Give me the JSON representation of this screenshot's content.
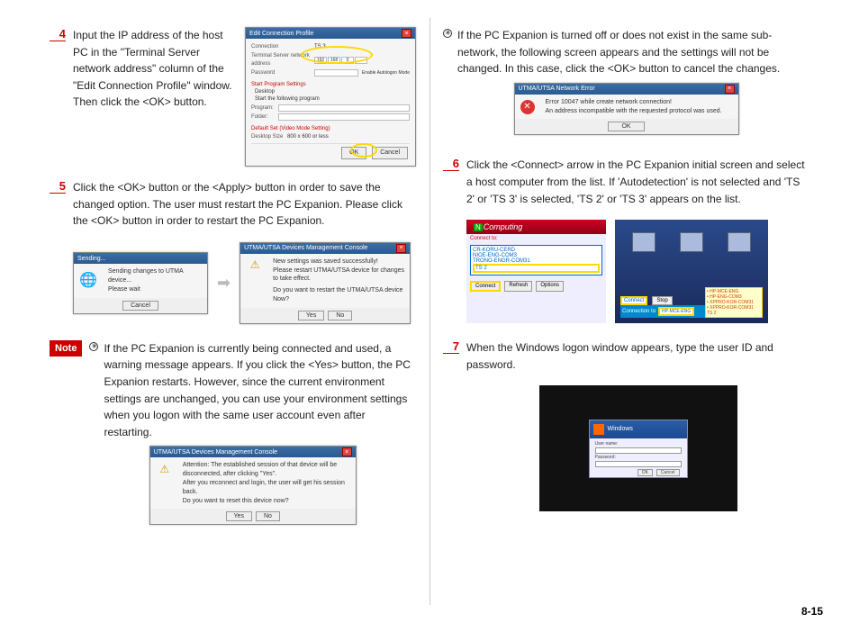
{
  "page_number": "8-15",
  "left": {
    "step4": {
      "num": "4",
      "text": "Input the IP address of the host PC in the \"Terminal Server network address\" column of the \"Edit Connection Profile\" window. Then click the <OK> button.",
      "dlg": {
        "title": "Edit Connection Profile",
        "conn_lbl": "Connection",
        "field1": "Terminal Server network address",
        "field2": "Password",
        "chk": "Enable Autologon Mode",
        "sect": "Start Program Settings",
        "opt1": "Desktop",
        "opt2": "Start the following program",
        "prog_lbl": "Program:",
        "fold_lbl": "Folder:",
        "mode_lbl": "Default Set (Video Mode Setting)",
        "desk_lbl": "Desktop Size",
        "desk_val": "800 x 600 or less",
        "ok": "OK",
        "cancel": "Cancel"
      }
    },
    "step5": {
      "num": "5",
      "text": "Click the <OK> button or the <Apply> button in order to save the changed option. The user must restart the PC Expanion. Please click the <OK> button in order to restart the PC Expanion.",
      "send": {
        "title": "Sending...",
        "msg": "Sending changes to UTMA device...\nPlease wait",
        "cancel": "Cancel"
      },
      "mgmt": {
        "title": "UTMA/UTSA Devices Management Console",
        "l1": "New settings was saved successfully!",
        "l2": "Please restart UTMA/UTSA device for changes to take effect.",
        "l3": "Do you want to restart the UTMA/UTSA device Now?",
        "yes": "Yes",
        "no": "No"
      }
    },
    "note": {
      "label": "Note",
      "b1": "If the PC Expanion is currently being connected and used, a warning message appears. If you click the <Yes> button, the PC Expanion restarts. However, since the current environment settings are unchanged, you can use your environment settings when you logon with the same user account even after restarting.",
      "dlg": {
        "title": "UTMA/UTSA Devices Management Console",
        "l1": "Attention: The established session of that device will be disconnected, after clicking \"Yes\".",
        "l2": "After you reconnect and login, the user will get his session back.",
        "l3": "Do you want to reset this device now?",
        "yes": "Yes",
        "no": "No"
      }
    }
  },
  "right": {
    "bullet_err": {
      "text": "If the PC Expanion is turned off or does not exist in the same sub-network, the following screen appears and the settings will not be changed. In this case, click the <OK> button to cancel the changes.",
      "dlg": {
        "title": "UTMA/UTSA Network Error",
        "l1": "Error 10047 while create network connection!",
        "l2": "An address incompatible with the requested protocol was used.",
        "ok": "OK"
      }
    },
    "step6": {
      "num": "6",
      "text": "Click the <Connect> arrow in the PC Expanion initial screen and select a host computer from the list. If 'Autodetection' is not selected and 'TS 2' or 'TS 3' is selected, 'TS 2' or 'TS 3' appears on the list.",
      "left_shot": {
        "brand": "Computing",
        "hdr": "Connect to:",
        "li1": "CR-KORU-CERD",
        "li2": "NIOE-ENG-COM3",
        "li3": "TRONO-ENGR-COM31",
        "li4": "TS 2",
        "connect": "Connect",
        "refresh": "Refresh",
        "options": "Options"
      },
      "right_shot": {
        "conn_to": "Connection to",
        "connect": "Connect",
        "stop": "Stop",
        "hi": "HP-MCE-ENG",
        "r1": "• HP-MCE-ENG",
        "r2": "• HP-ENG-COM3",
        "r3": "• XPPRO-KOR-COM31",
        "r4": "• XPPRO-KOR-COM31",
        "r5": "TS 2"
      }
    },
    "step7": {
      "num": "7",
      "text": "When the Windows logon window appears, type the user ID and password.",
      "win": "Windows"
    }
  }
}
